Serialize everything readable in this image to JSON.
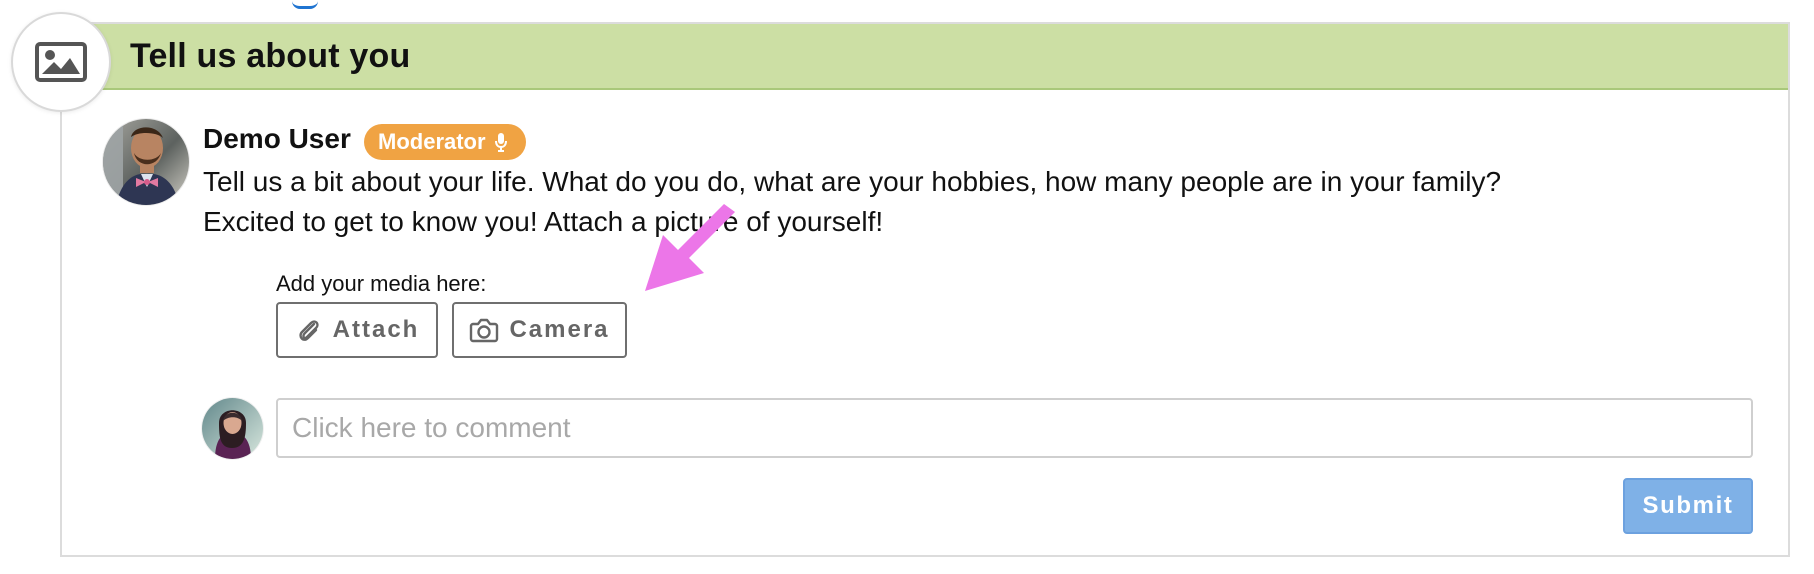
{
  "section": {
    "title": "Tell us about you",
    "icon": "image-icon"
  },
  "post": {
    "author": {
      "name": "Demo User",
      "role_badge": "Moderator",
      "badge_icon": "microphone-icon",
      "avatar": "user-avatar"
    },
    "lines": [
      "Tell us a bit about your life. What do you do, what are your hobbies, how many people are in your family?",
      "Excited to get to know you! Attach a picture of yourself!"
    ]
  },
  "media": {
    "label": "Add your media here:",
    "buttons": [
      {
        "label": "Attach",
        "icon": "paperclip-icon"
      },
      {
        "label": "Camera",
        "icon": "camera-icon"
      }
    ],
    "annotation_icon": "pink-arrow-icon"
  },
  "comment": {
    "placeholder": "Click here to comment",
    "value": "",
    "submit_label": "Submit",
    "avatar": "commenter-avatar"
  },
  "colors": {
    "header_background": "#ccdfa4",
    "header_border": "#a9c87a",
    "moderator_badge": "#f0a343",
    "submit_button": "#7fb1e7",
    "arrow": "#ec76e8"
  }
}
